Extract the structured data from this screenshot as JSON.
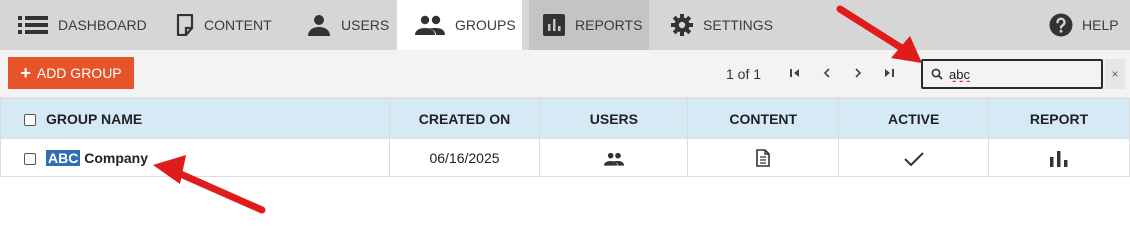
{
  "nav": {
    "items": [
      {
        "label": "DASHBOARD",
        "icon": "dashboard-list-icon"
      },
      {
        "label": "CONTENT",
        "icon": "content-page-icon"
      },
      {
        "label": "USERS",
        "icon": "user-icon"
      },
      {
        "label": "GROUPS",
        "icon": "groups-icon",
        "active": true
      },
      {
        "label": "REPORTS",
        "icon": "bar-chart-icon"
      },
      {
        "label": "SETTINGS",
        "icon": "gear-icon"
      }
    ],
    "help_label": "HELP"
  },
  "toolbar": {
    "add_label": "ADD GROUP",
    "pager_text": "1 of 1",
    "search_value": "abc",
    "clear_label": "×"
  },
  "table": {
    "headers": [
      "GROUP NAME",
      "CREATED ON",
      "USERS",
      "CONTENT",
      "ACTIVE",
      "REPORT"
    ],
    "rows": [
      {
        "name_highlight": "ABC",
        "name_rest": " Company",
        "created_on": "06/16/2025",
        "active": true
      }
    ]
  },
  "colors": {
    "accent": "#e8542a",
    "nav_bg": "#d6d6d6",
    "header_bg": "#d5eaf5",
    "highlight": "#2f6fb0",
    "annotation_arrow": "#e01b1b"
  }
}
